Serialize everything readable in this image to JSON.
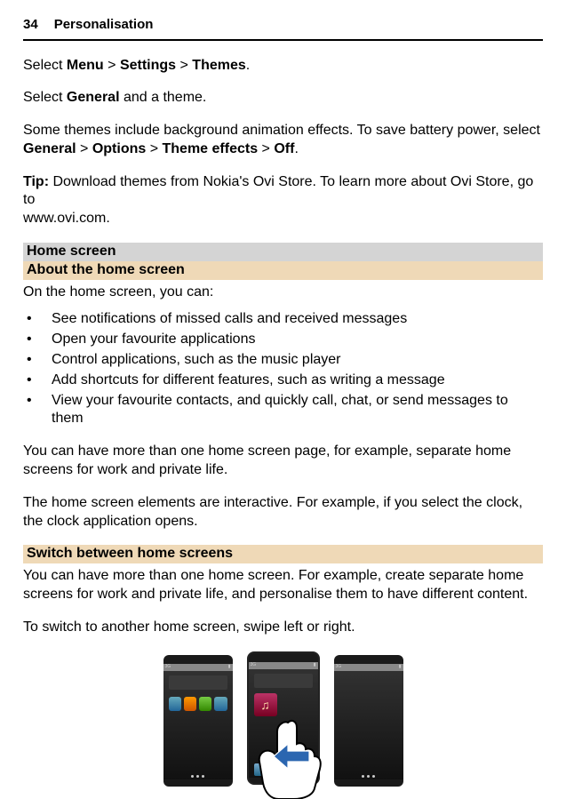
{
  "header": {
    "pageNumber": "34",
    "sectionTitle": "Personalisation"
  },
  "p1": {
    "prefix": "Select ",
    "menu": "Menu",
    "gt1": " > ",
    "settings": "Settings",
    "gt2": " > ",
    "themes": "Themes",
    "suffix": "."
  },
  "p2": {
    "prefix": "Select ",
    "general": "General",
    "suffix": " and a theme."
  },
  "p3": {
    "line1": "Some themes include background animation effects. To save battery power, select",
    "general": "General",
    "gt1": " > ",
    "options": "Options",
    "gt2": " > ",
    "themeEffects": "Theme effects",
    "gt3": " > ",
    "off": "Off",
    "suffix": "."
  },
  "tip": {
    "label": "Tip:",
    "text1": " Download themes from Nokia's Ovi Store. To learn more about Ovi Store, go to",
    "text2": "www.ovi.com."
  },
  "sec1": {
    "heading": "Home screen",
    "subheading": "About the home screen"
  },
  "p4": "On the home screen, you can:",
  "bullets": [
    "See notifications of missed calls and received messages",
    "Open your favourite applications",
    "Control applications, such as the music player",
    "Add shortcuts for different features, such as writing a message",
    "View your favourite contacts, and quickly call, chat, or send messages to them"
  ],
  "p5": "You can have more than one home screen page, for example, separate home screens for work and private life.",
  "p6": "The home screen elements are interactive. For example, if you select the clock, the clock application opens.",
  "sec2": {
    "heading": "Switch between home screens"
  },
  "p7": "You can have more than one home screen. For example, create separate home screens for work and private life, and personalise them to have different content.",
  "p8": "To switch to another home screen, swipe left or right."
}
